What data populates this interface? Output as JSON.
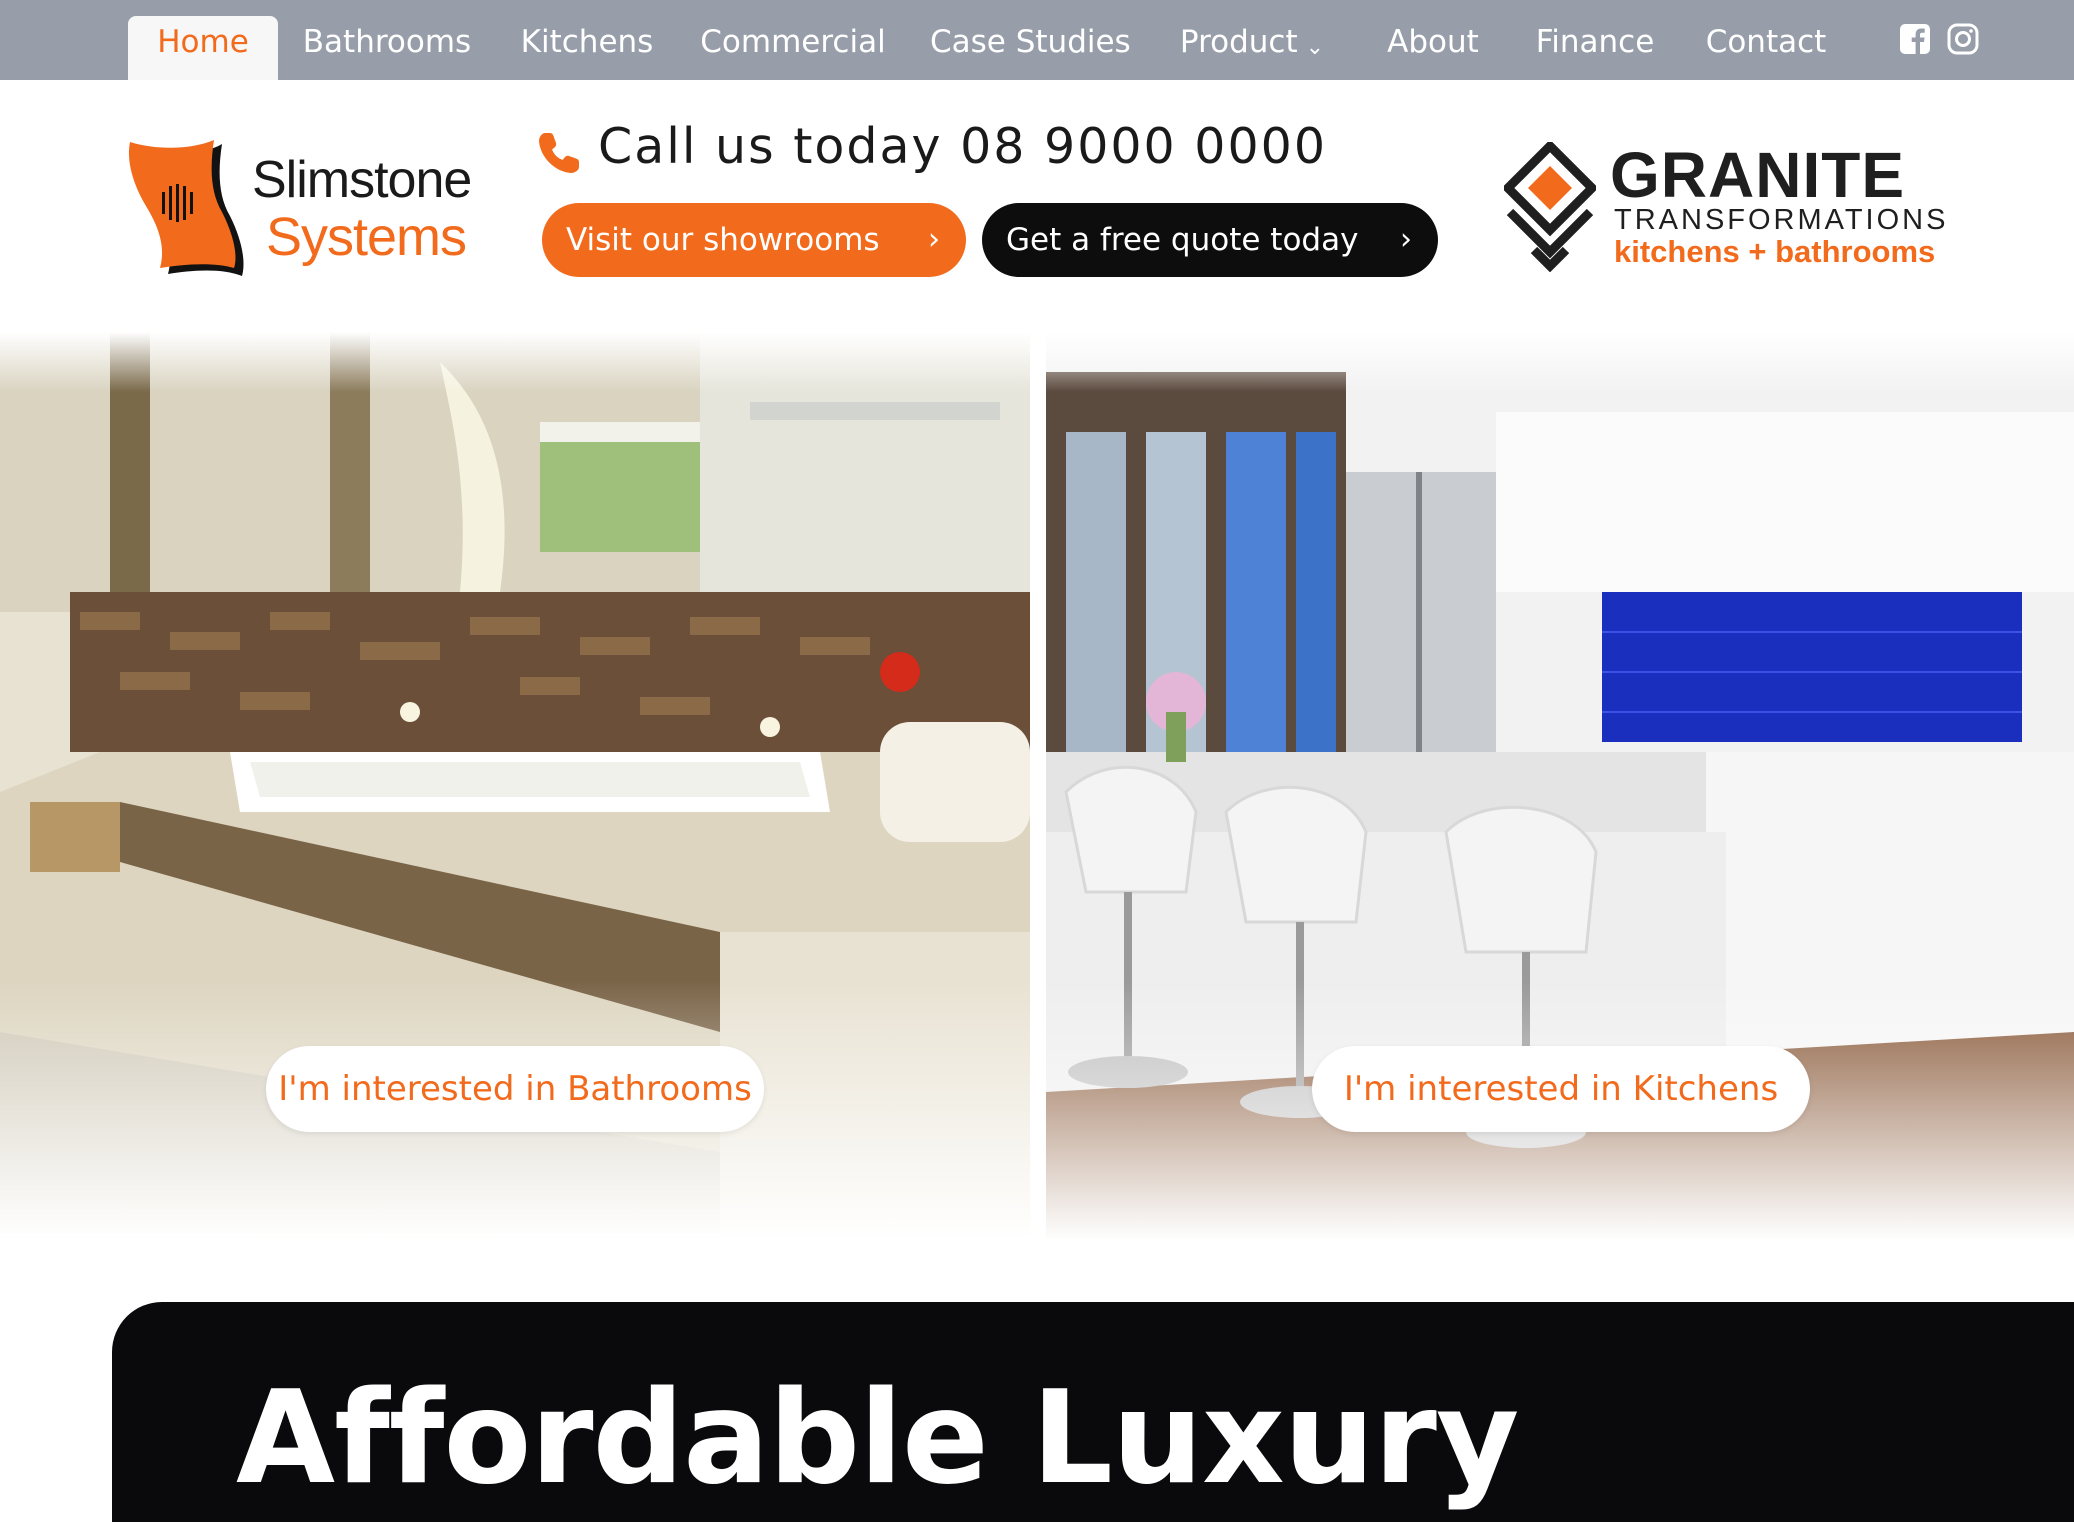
{
  "nav": {
    "items": [
      {
        "label": "Home",
        "active": true
      },
      {
        "label": "Bathrooms"
      },
      {
        "label": "Kitchens"
      },
      {
        "label": "Commercial"
      },
      {
        "label": "Case Studies"
      },
      {
        "label": "Product"
      },
      {
        "label": "About"
      },
      {
        "label": "Finance"
      },
      {
        "label": "Contact"
      }
    ],
    "product_caret": "⌄",
    "social": [
      "facebook-icon",
      "instagram-icon"
    ]
  },
  "brand": {
    "line1": "Slimstone",
    "line2": "Systems"
  },
  "header": {
    "phone_label": "Call us today 08 9000 0000",
    "showroom_button": "Visit our showrooms",
    "quote_button": "Get a free quote today",
    "chevron": "›"
  },
  "partner": {
    "title": "GRANITE",
    "subtitle": "TRANSFORMATIONS",
    "tagline": "kitchens + bathrooms"
  },
  "hero": {
    "bathrooms_cta": "I'm interested in Bathrooms",
    "kitchens_cta": "I'm interested in Kitchens"
  },
  "banner": {
    "title": "Affordable Luxury"
  },
  "colors": {
    "accent": "#f26b1d",
    "nav_bg": "#979ea9",
    "dark": "#0d0d0d"
  }
}
